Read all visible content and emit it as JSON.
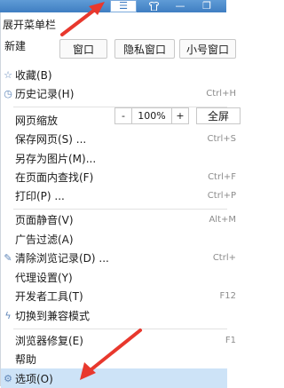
{
  "titlebar": {
    "menu_icon": "hamburger-menu-icon",
    "skin_icon": "tshirt-skin-icon",
    "minimize_icon": "minimize-icon",
    "restore_icon": "restore-window-icon"
  },
  "menu": {
    "expand_label": "展开菜单栏",
    "new_label": "新建",
    "new_buttons": [
      "窗口",
      "隐私窗口",
      "小号窗口"
    ],
    "items": {
      "favorites": "收藏(B)",
      "history": {
        "label": "历史记录(H)",
        "shortcut": "Ctrl+H"
      },
      "zoom": {
        "label": "网页缩放",
        "minus": "-",
        "value": "100%",
        "plus": "+",
        "fullscreen": "全屏"
      },
      "save_page": {
        "label": "保存网页(S) ...",
        "shortcut": "Ctrl+S"
      },
      "save_as_image": {
        "label": "另存为图片(M)..."
      },
      "find": {
        "label": "在页面内查找(F)",
        "shortcut": "Ctrl+F"
      },
      "print": {
        "label": "打印(P) ...",
        "shortcut": "Ctrl+P"
      },
      "mute": {
        "label": "页面静音(V)",
        "shortcut": "Alt+M"
      },
      "adblock": {
        "label": "广告过滤(A)"
      },
      "clear_data": {
        "label": "清除浏览记录(D) ...",
        "shortcut": "Ctrl+"
      },
      "proxy": {
        "label": "代理设置(Y)"
      },
      "devtools": {
        "label": "开发者工具(T)",
        "shortcut": "F12"
      },
      "compat_mode": {
        "label": "切换到兼容模式"
      },
      "repair": {
        "label": "浏览器修复(E)",
        "shortcut": "F1"
      },
      "help": {
        "label": "帮助"
      },
      "options": {
        "label": "选项(O)"
      }
    }
  },
  "colors": {
    "titlebar": "#4a87c8",
    "highlight": "#cde3f7",
    "arrow": "#e8382d"
  }
}
